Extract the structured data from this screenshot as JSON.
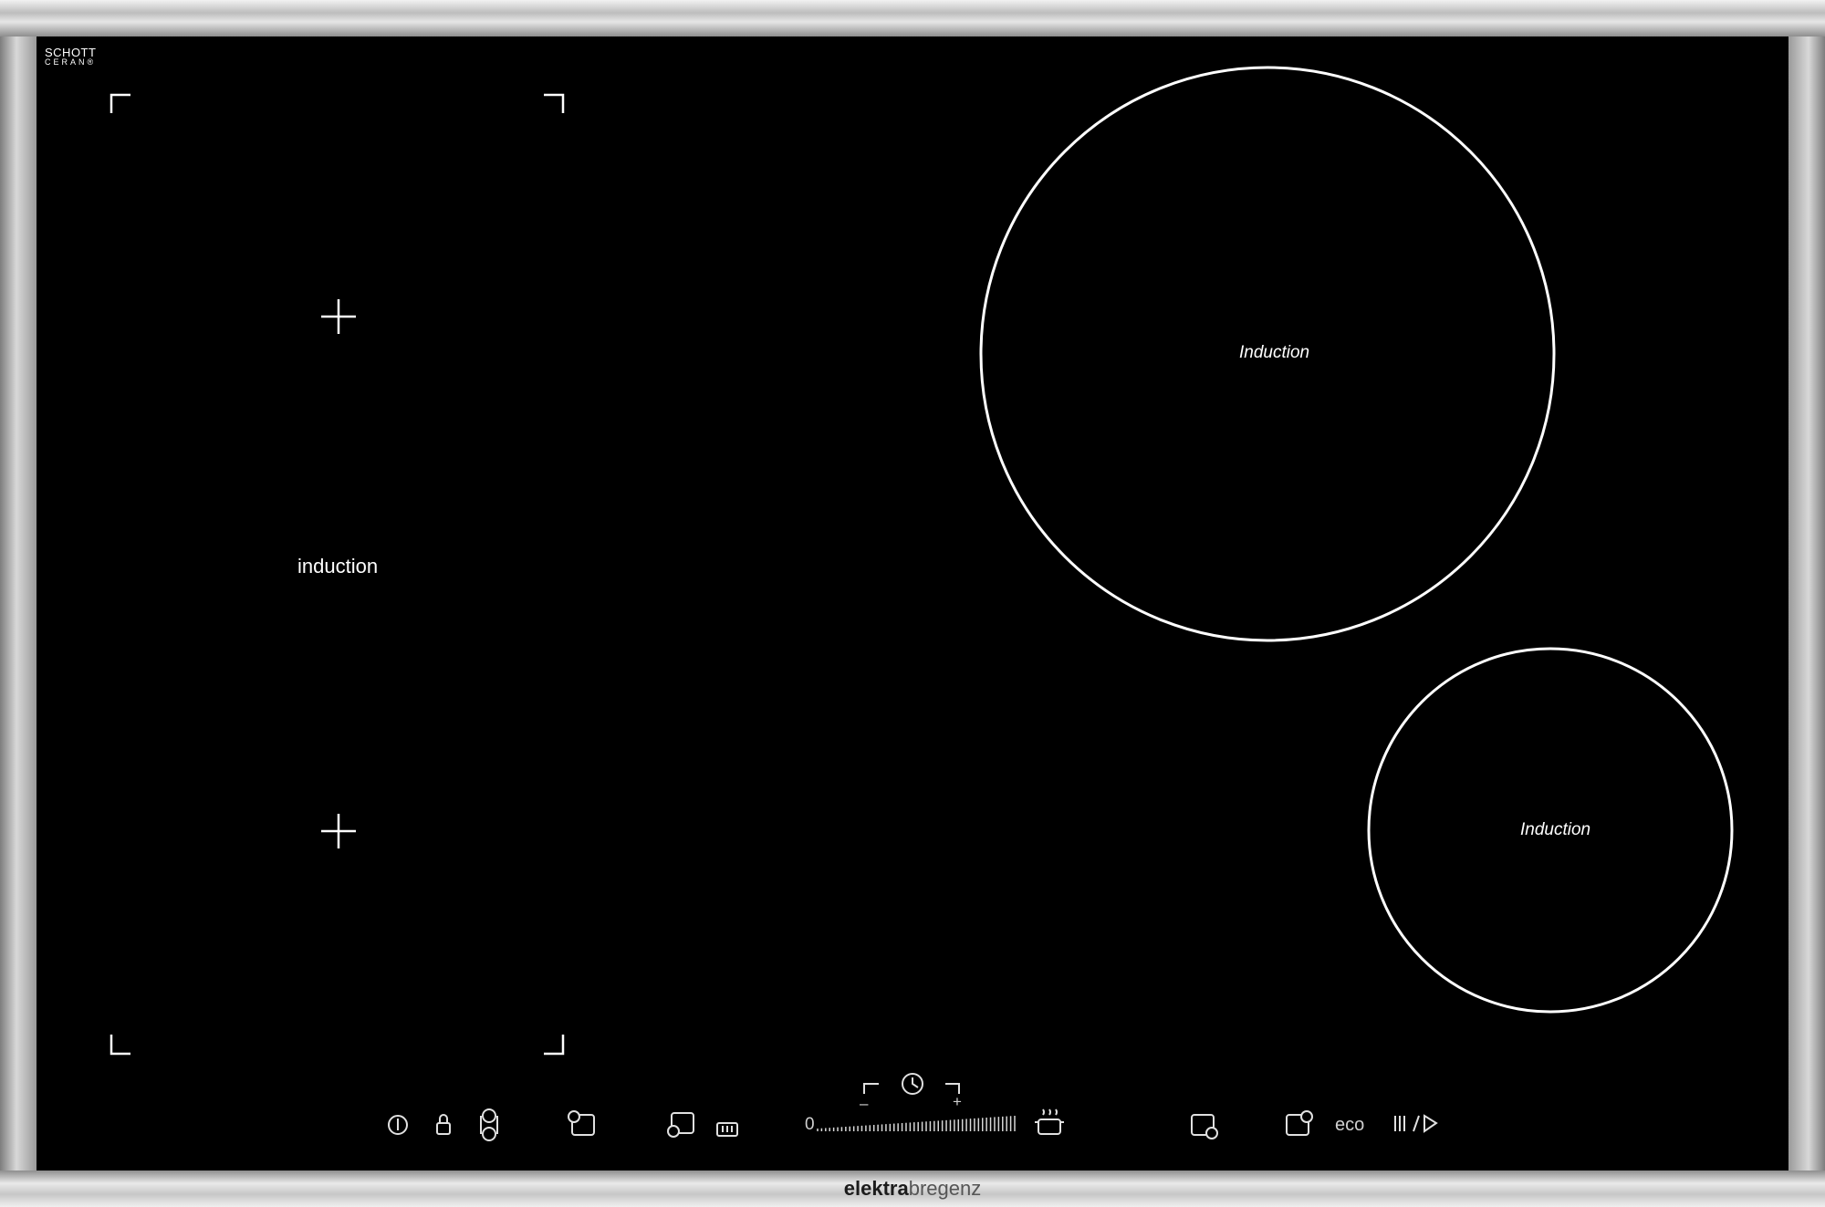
{
  "glass_brand": {
    "line1": "SCHOTT",
    "line2": "CERAN®"
  },
  "zones": {
    "flex_zone_label": "induction",
    "large_zone_label": "Induction",
    "small_zone_label": "Induction"
  },
  "controls": {
    "slider_min": "0",
    "minus": "–",
    "plus": "+",
    "eco": "eco"
  },
  "brand": {
    "part1": "elektra",
    "part2": "bregenz"
  },
  "colors": {
    "glass": "#000000",
    "markings": "#ffffff",
    "frame": "#c8c8c8"
  }
}
